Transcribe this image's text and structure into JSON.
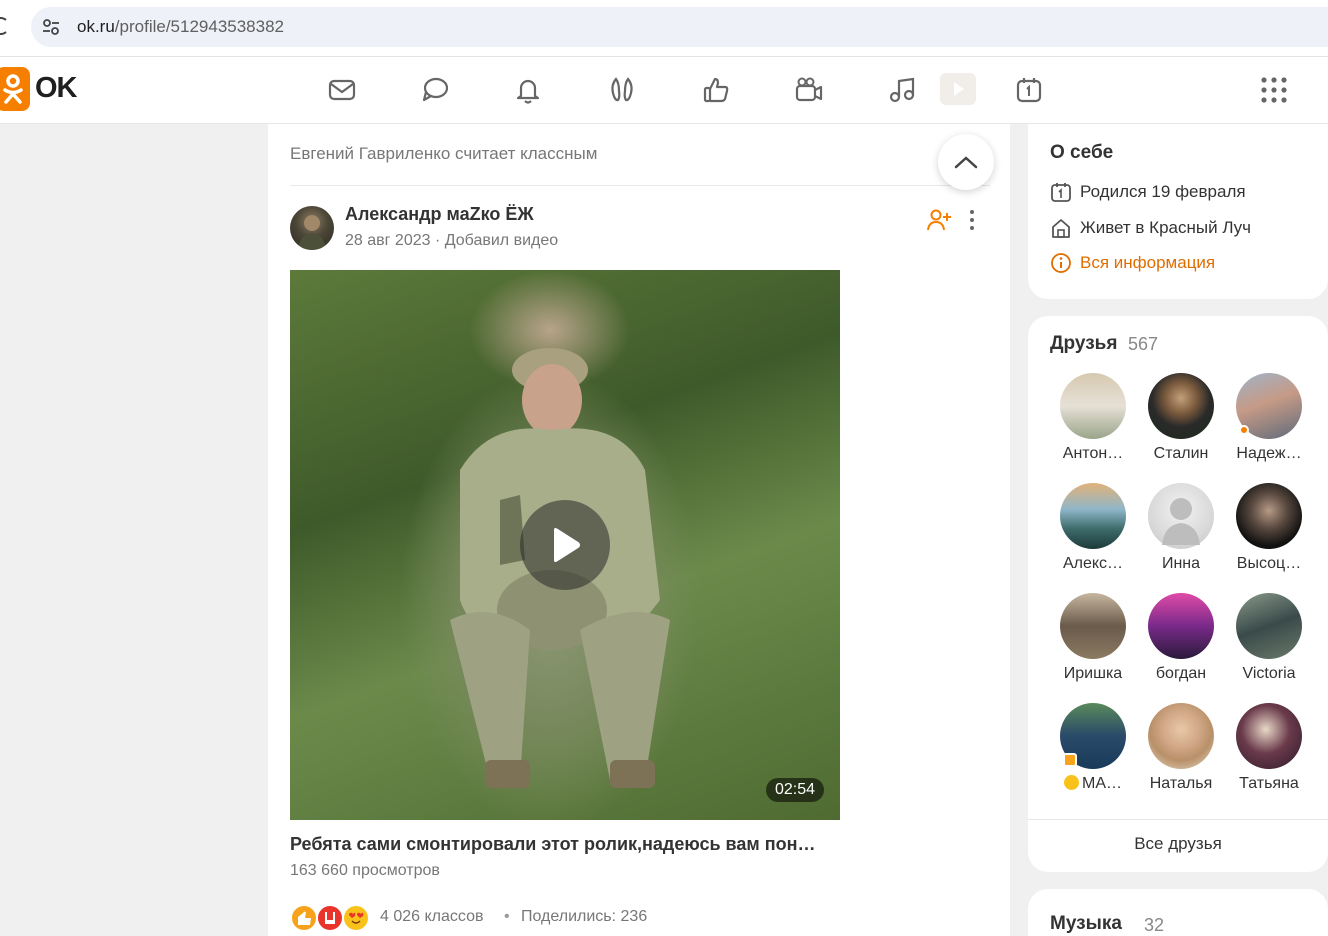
{
  "browser": {
    "url_host": "ok.ru",
    "url_path": "/profile/512943538382"
  },
  "header": {
    "logo_text": "OK",
    "nav_icons": [
      "mail-icon",
      "discussions-icon",
      "notifications-icon",
      "guests-icon",
      "likes-icon",
      "video-icon",
      "music-icon",
      "video-player-icon",
      "calendar-icon",
      "apps-icon"
    ],
    "brand_color": "#f77f00"
  },
  "feed": {
    "caption": "Евгений Гавриленко считает классным",
    "post": {
      "author": "Александр маZко ЁЖ",
      "date": "28 авг 2023",
      "action": "Добавил видео",
      "meta_separator": " · ",
      "video_duration": "02:54",
      "video_title": "Ребята сами смонтировали этот ролик,надеюсь вам пон…",
      "views": "163 660 просмотров",
      "likes": "4 026 классов",
      "separator": "•",
      "shares": "Поделились: 236"
    }
  },
  "about": {
    "title": "О себе",
    "birthday": "Родился 19 февраля",
    "lives": "Живет в Красный Луч",
    "all_info": "Вся информация",
    "link_color": "#e06d00"
  },
  "friends": {
    "title": "Друзья",
    "count": "567",
    "items": [
      {
        "name": "Антон…"
      },
      {
        "name": "Сталин"
      },
      {
        "name": "Надеж…"
      },
      {
        "name": "Алекс…"
      },
      {
        "name": "Инна"
      },
      {
        "name": "Высоц…"
      },
      {
        "name": "Иришка"
      },
      {
        "name": "богдан"
      },
      {
        "name": "Victoria"
      },
      {
        "name": "МА…"
      },
      {
        "name": "Наталья"
      },
      {
        "name": "Татьяна"
      }
    ],
    "all_label": "Все друзья"
  },
  "music": {
    "title": "Музыка",
    "count": "32"
  }
}
